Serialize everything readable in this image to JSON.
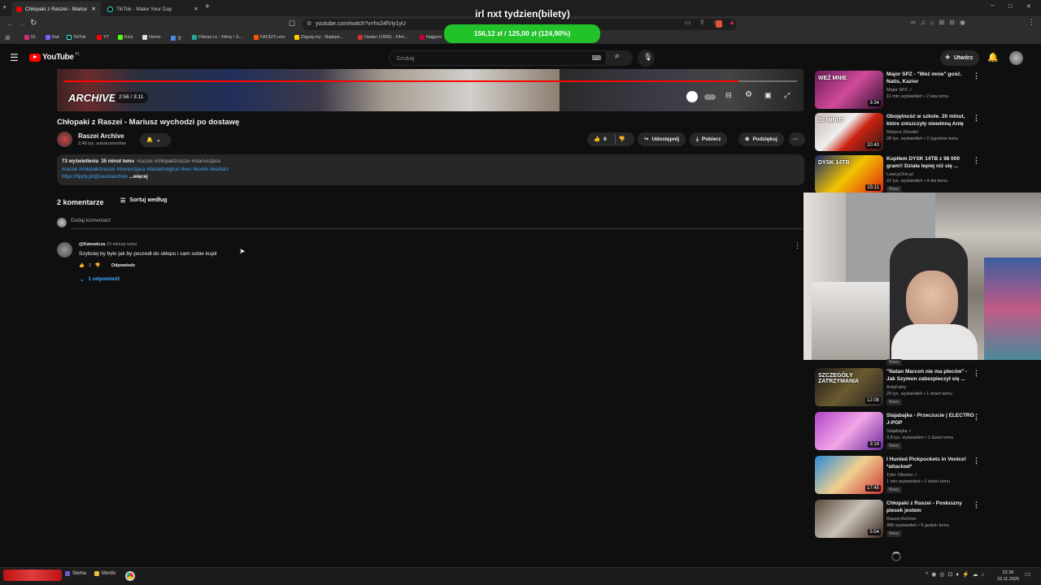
{
  "browser": {
    "tabs": [
      {
        "label": "Chłopaki z Raszei - Mariusz wyc",
        "active": true
      },
      {
        "label": "TikTok - Make Your Day",
        "active": false
      }
    ],
    "new_tab_symbol": "+",
    "url": "youtube.com/watch?v=hs34fViy1yU",
    "window_controls": [
      "─",
      "□",
      "✕"
    ],
    "bookmarks": [
      "IG",
      "Rat",
      "TikTok",
      "YT",
      "Kick",
      "Home",
      "文",
      "Filman.cc - Filmy i S...",
      "FACEIT.com",
      "Zagraj.my - Najleps...",
      "Dealer (1996) - Film...",
      "Najgors"
    ]
  },
  "overlay": {
    "title": "irl nxt tydzien(bilety)",
    "pill": "156,12 zł / 125,00 zł (124,90%)"
  },
  "yt_header": {
    "logo": "YouTube",
    "logo_region": "PL",
    "search_placeholder": "Szukaj",
    "create_label": "Utwórz"
  },
  "player": {
    "watermark": "ARCHIVE",
    "time": "2:56 / 3:11",
    "progress_fraction": 0.92
  },
  "video": {
    "title": "Chłopaki z Raszei - Mariusz wychodzi po dostawę",
    "channel": "Raszei Archive",
    "subscribers": "2,48 tys. subskrybentów",
    "likes": "6",
    "share_label": "Udostępnij",
    "download_label": "Pobierz",
    "thanks_label": "Podziękuj",
    "more_label": "···"
  },
  "description": {
    "views": "73 wyświetlenia",
    "age": "35 minut temu",
    "hashtags_line1": "#raszei #chłopakizraszei #mariuszjaca",
    "hashtags_line2": "#raszei #chłopakizraszei #mariuszjaca #danielmagical #kws #korkin #korkarz",
    "link": "https://tipply.pl/@raszeiarchive",
    "more": "...więcej"
  },
  "comments": {
    "count_label": "2 komentarze",
    "sort_label": "Sortuj według",
    "add_placeholder": "Dodaj komentarz",
    "items": [
      {
        "author": "@Katowicza",
        "time": "23 minuty temu",
        "text": "Szybciej by było jak by poszedł do sklepu i sam sobie kupił",
        "likes": "3",
        "reply_label": "Odpowiedz",
        "replies_label": "1 odpowiedź"
      }
    ]
  },
  "related": [
    {
      "title": "Major SPZ - \"Weź mnie\" gość. Natis, Kazior",
      "channel": "Major SPZ ✓",
      "meta": "11 mln wyświetleń • 2 lata temu",
      "duration": "3:34",
      "badge": "",
      "thumb_text": "WEŹ MNIE"
    },
    {
      "title": "Obojętność w szkole. 20 minut, które zniszczyły niewinną Anię",
      "channel": "Miejsce Zbrodni",
      "meta": "28 tys. wyświetleń • 2 tygodnie temu",
      "duration": "20:40",
      "badge": "",
      "thumb_text": "20 MINUT"
    },
    {
      "title": "Kupiłem DYSK 14TB z 98 000 gram!! Działa lepiej niż się ...",
      "channel": "LowcyChin.pl",
      "meta": "22 tys. wyświetleń • 4 dni temu",
      "duration": "15:11",
      "badge": "Nowy",
      "thumb_text": "DYSK 14TB"
    },
    {
      "title": "\"Natan Marcoń nie ma pleców\" - Jak Szymon zabezpieczył się ...",
      "channel": "AntyFakty",
      "meta": "29 tys. wyświetleń • 1 dzień temu",
      "duration": "12:08",
      "badge": "Nowy",
      "thumb_text": "SZCZEGÓŁY ZATRZYMANIA"
    },
    {
      "title": "Slajabajka - Przeczucie | ELECTRO J-POP",
      "channel": "Slajabajka ✓",
      "meta": "3,8 tys. wyświetleń • 1 dzień temu",
      "duration": "3:14",
      "badge": "Nowy",
      "thumb_text": ""
    },
    {
      "title": "I Hunted Pickpockets in Venice! *attacked*",
      "channel": "Tyler Oliveira ✓",
      "meta": "1 mln wyświetleń • 1 dzień temu",
      "duration": "17:45",
      "badge": "Nowy",
      "thumb_text": ""
    },
    {
      "title": "Chłopaki z Raszei - Posłuszny piesek jestem",
      "channel": "Raszei Archive",
      "meta": "498 wyświetleń • 9 godzin temu",
      "duration": "5:54",
      "badge": "Nowy",
      "thumb_text": ""
    }
  ],
  "webcam_badge": "Nowy",
  "taskbar": {
    "apps": [
      "Siema",
      "Mordo"
    ],
    "clock_time": "22:36",
    "clock_date": "23.11.2025"
  },
  "colors": {
    "accent": "#ff0000",
    "link": "#3ea6ff",
    "overlay_green": "#22c22a"
  }
}
